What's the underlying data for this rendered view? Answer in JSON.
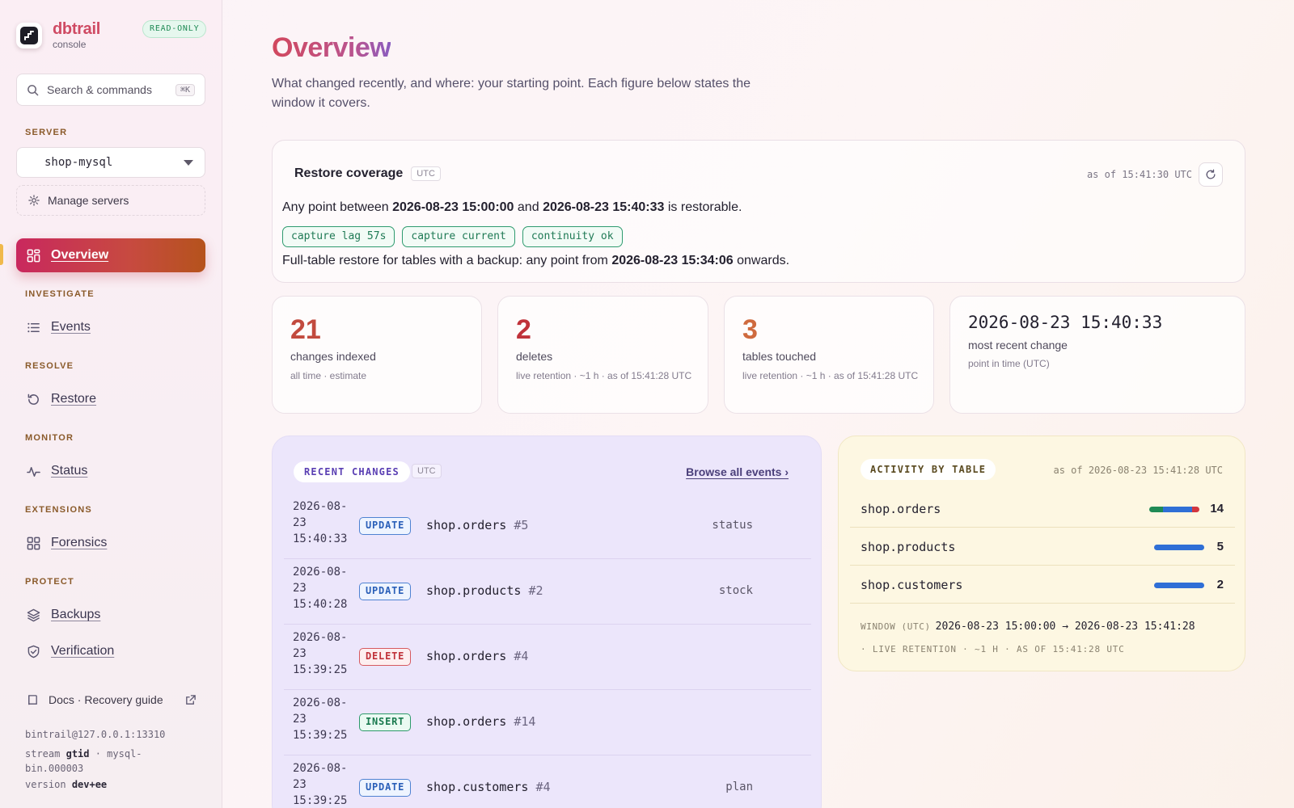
{
  "brand": {
    "name": "dbtrail",
    "subtitle": "console",
    "mode_badge": "READ-ONLY"
  },
  "search": {
    "placeholder": "Search & commands",
    "shortcut": "⌘K"
  },
  "sidebar": {
    "server_label": "SERVER",
    "server_selected": "shop-mysql",
    "manage_servers": "Manage servers",
    "nav": [
      {
        "section": "",
        "label": "Overview",
        "icon": "grid-icon",
        "active": true
      },
      {
        "section": "INVESTIGATE",
        "label": "Events",
        "icon": "list-icon"
      },
      {
        "section": "RESOLVE",
        "label": "Restore",
        "icon": "history-icon"
      },
      {
        "section": "MONITOR",
        "label": "Status",
        "icon": "pulse-icon"
      },
      {
        "section": "EXTENSIONS",
        "label": "Forensics",
        "icon": "apps-icon"
      },
      {
        "section": "PROTECT",
        "label": "Backups",
        "icon": "layers-icon"
      },
      {
        "section": "",
        "label": "Verification",
        "icon": "shield-check-icon"
      }
    ],
    "docs": "Docs · Recovery guide",
    "footer": {
      "connection": "bintrail@127.0.0.1:13310",
      "stream_prefix": "stream",
      "stream_mode": "gtid",
      "stream_file": "· mysql-bin.000003",
      "version_prefix": "version",
      "version": "dev+ee"
    }
  },
  "page": {
    "title": "Overview",
    "subtitle": "What changed recently, and where: your starting point. Each figure below states the window it covers."
  },
  "coverage": {
    "title": "Restore coverage",
    "tz": "UTC",
    "as_of": "as of 15:41:30 UTC",
    "line1_prefix": "Any point between",
    "range_start": "2026-08-23 15:00:00",
    "line1_mid": "and",
    "range_end": "2026-08-23 15:40:33",
    "line1_suffix": "is restorable.",
    "pills": [
      "capture lag 57s",
      "capture current",
      "continuity ok"
    ],
    "line2_prefix": "Full-table restore for tables with a backup: any point from",
    "backup_from": "2026-08-23 15:34:06",
    "line2_suffix": "onwards."
  },
  "stats": [
    {
      "value": "21",
      "label": "changes indexed",
      "sub": "all time · estimate",
      "color": "#c24a3e"
    },
    {
      "value": "2",
      "label": "deletes",
      "sub": "live retention · ~1 h · as of 15:41:28 UTC",
      "color": "#c0323a"
    },
    {
      "value": "3",
      "label": "tables touched",
      "sub": "live retention · ~1 h · as of 15:41:28 UTC",
      "color": "#cf6a3e"
    },
    {
      "value": "2026-08-23 15:40:33",
      "label": "most recent change",
      "sub": "point in time (UTC)"
    }
  ],
  "recent": {
    "title": "RECENT CHANGES",
    "tz": "UTC",
    "browse": "Browse all events ›",
    "rows": [
      {
        "date": "2026-08-23",
        "time": "15:40:33",
        "op": "UPDATE",
        "table": "shop.orders",
        "id": "#5",
        "field": "status"
      },
      {
        "date": "2026-08-23",
        "time": "15:40:28",
        "op": "UPDATE",
        "table": "shop.products",
        "id": "#2",
        "field": "stock"
      },
      {
        "date": "2026-08-23",
        "time": "15:39:25",
        "op": "DELETE",
        "table": "shop.orders",
        "id": "#4",
        "field": ""
      },
      {
        "date": "2026-08-23",
        "time": "15:39:25",
        "op": "INSERT",
        "table": "shop.orders",
        "id": "#14",
        "field": ""
      },
      {
        "date": "2026-08-23",
        "time": "15:39:25",
        "op": "UPDATE",
        "table": "shop.customers",
        "id": "#4",
        "field": "plan"
      }
    ]
  },
  "activity": {
    "title": "ACTIVITY BY TABLE",
    "as_of": "as of 2026-08-23 15:41:28 UTC",
    "rows": [
      {
        "table": "shop.orders",
        "count": "14",
        "segments": [
          {
            "share": 0.28,
            "color": "#1f8a55"
          },
          {
            "share": 0.57,
            "color": "#2f6fd6"
          },
          {
            "share": 0.15,
            "color": "#d2363f"
          }
        ]
      },
      {
        "table": "shop.products",
        "count": "5",
        "segments": [
          {
            "share": 1,
            "color": "#2f6fd6"
          }
        ]
      },
      {
        "table": "shop.customers",
        "count": "2",
        "segments": [
          {
            "share": 1,
            "color": "#2f6fd6"
          }
        ]
      }
    ],
    "window_label": "WINDOW (UTC)",
    "window_range": "2026-08-23 15:00:00 → 2026-08-23 15:41:28",
    "window_note": "· LIVE RETENTION · ~1 H · AS OF 15:41:28 UTC"
  }
}
